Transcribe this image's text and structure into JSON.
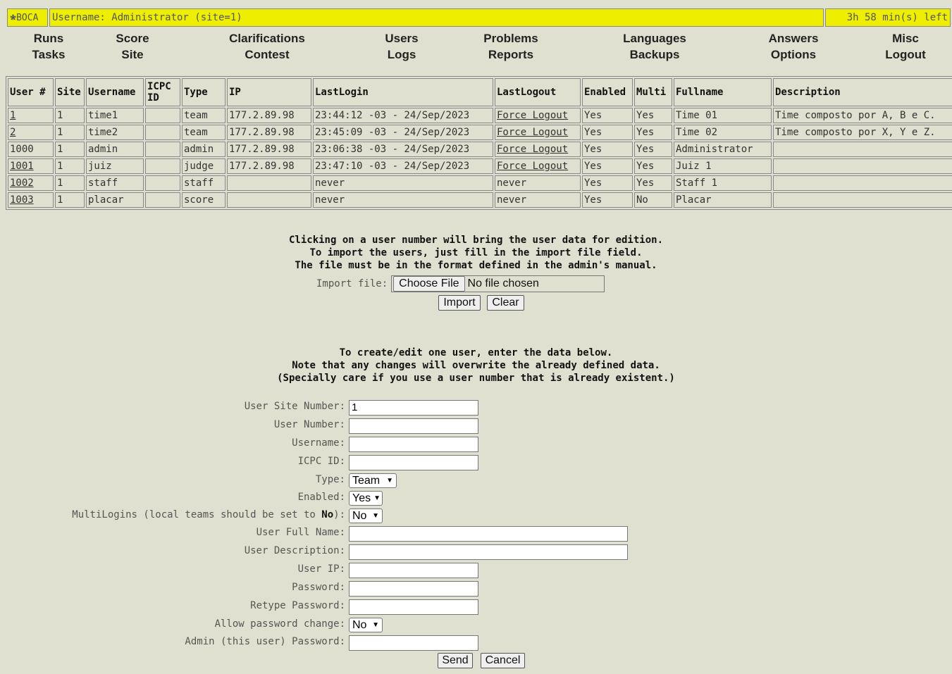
{
  "header": {
    "logo_text": "BOCA",
    "user_info": "Username: Administrator (site=1)",
    "time_left": "3h 58 min(s) left"
  },
  "nav": [
    {
      "top": "Runs",
      "bottom": "Tasks"
    },
    {
      "top": "Score",
      "bottom": "Site"
    },
    {
      "top": "Clarifications",
      "bottom": "Contest"
    },
    {
      "top": "Users",
      "bottom": "Logs"
    },
    {
      "top": "Problems",
      "bottom": "Reports"
    },
    {
      "top": "Languages",
      "bottom": "Backups"
    },
    {
      "top": "Answers",
      "bottom": "Options"
    },
    {
      "top": "Misc",
      "bottom": "Logout"
    }
  ],
  "users_table": {
    "columns": [
      "User #",
      "Site",
      "Username",
      "ICPC ID",
      "Type",
      "IP",
      "LastLogin",
      "LastLogout",
      "Enabled",
      "Multi",
      "Fullname",
      "Description"
    ],
    "rows": [
      [
        "1",
        "1",
        "time1",
        "",
        "team",
        "177.2.89.98",
        "23:44:12 -03 - 24/Sep/2023",
        "Force Logout",
        "Yes",
        "Yes",
        "Time 01",
        "Time composto por A, B e C."
      ],
      [
        "2",
        "1",
        "time2",
        "",
        "team",
        "177.2.89.98",
        "23:45:09 -03 - 24/Sep/2023",
        "Force Logout",
        "Yes",
        "Yes",
        "Time 02",
        "Time composto por X, Y e Z."
      ],
      [
        "1000",
        "1",
        "admin",
        "",
        "admin",
        "177.2.89.98",
        "23:06:38 -03 - 24/Sep/2023",
        "Force Logout",
        "Yes",
        "Yes",
        "Administrator",
        ""
      ],
      [
        "1001",
        "1",
        "juiz",
        "",
        "judge",
        "177.2.89.98",
        "23:47:10 -03 - 24/Sep/2023",
        "Force Logout",
        "Yes",
        "Yes",
        "Juiz 1",
        ""
      ],
      [
        "1002",
        "1",
        "staff",
        "",
        "staff",
        "",
        "never",
        "never",
        "Yes",
        "Yes",
        "Staff 1",
        ""
      ],
      [
        "1003",
        "1",
        "placar",
        "",
        "score",
        "",
        "never",
        "never",
        "Yes",
        "No",
        "Placar",
        ""
      ]
    ]
  },
  "import_info": [
    "Clicking on a user number will bring the user data for edition.",
    "To import the users, just fill in the import file field.",
    "The file must be in the format defined in the admin's manual."
  ],
  "import": {
    "label": "Import file:",
    "choose_file": "Choose File",
    "no_file": "No file chosen",
    "import_button": "Import",
    "clear_button": "Clear"
  },
  "edit_info": [
    "To create/edit one user, enter the data below.",
    "Note that any changes will overwrite the already defined data.",
    "(Specially care if you use a user number that is already existent.)"
  ],
  "form": {
    "site_number_label": "User Site Number:",
    "site_number_value": "1",
    "user_number_label": "User Number:",
    "username_label": "Username:",
    "icpc_id_label": "ICPC ID:",
    "type_label": "Type:",
    "type_value": "Team",
    "enabled_label": "Enabled:",
    "enabled_value": "Yes",
    "multilogins_label": "MultiLogins (local teams should be set to ",
    "multilogins_bold": "No",
    "multilogins_end": "):",
    "multilogins_value": "No",
    "fullname_label": "User Full Name:",
    "description_label": "User Description:",
    "ip_label": "User IP:",
    "password_label": "Password:",
    "retype_label": "Retype Password:",
    "allow_change_label": "Allow password change:",
    "allow_change_value": "No",
    "admin_password_label": "Admin (this user) Password:",
    "send_button": "Send",
    "cancel_button": "Cancel"
  }
}
